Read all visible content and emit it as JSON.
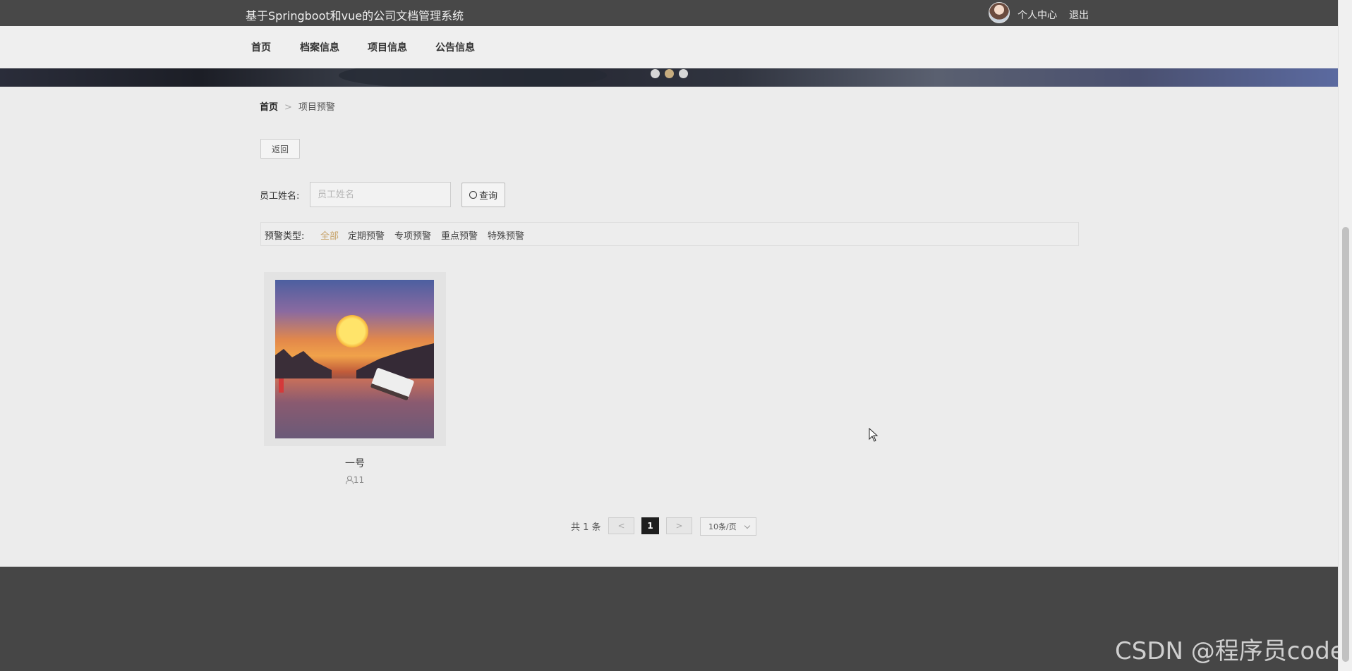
{
  "header": {
    "title": "基于Springboot和vue的公司文档管理系统",
    "personal_center": "个人中心",
    "logout": "退出"
  },
  "nav": {
    "items": [
      "首页",
      "档案信息",
      "项目信息",
      "公告信息"
    ]
  },
  "banner": {
    "dot_count": 3,
    "active_index": 1
  },
  "breadcrumb": {
    "home": "首页",
    "separator": ">",
    "current": "项目预警"
  },
  "back_button": "返回",
  "search": {
    "label": "员工姓名:",
    "placeholder": "员工姓名",
    "value": "",
    "button": "查询"
  },
  "filter": {
    "label": "预警类型:",
    "options": [
      "全部",
      "定期预警",
      "专项预警",
      "重点预警",
      "特殊预警"
    ],
    "active": "全部"
  },
  "cards": [
    {
      "title": "一号",
      "meta": "11"
    }
  ],
  "pagination": {
    "total": "共 1 条",
    "prev": "<",
    "current": "1",
    "next": ">",
    "page_size": "10条/页"
  },
  "watermark": "CSDN @程序员code",
  "colors": {
    "topbar": "#484848",
    "accent": "#c7a36a",
    "footer": "#464646",
    "background": "#ececec"
  }
}
